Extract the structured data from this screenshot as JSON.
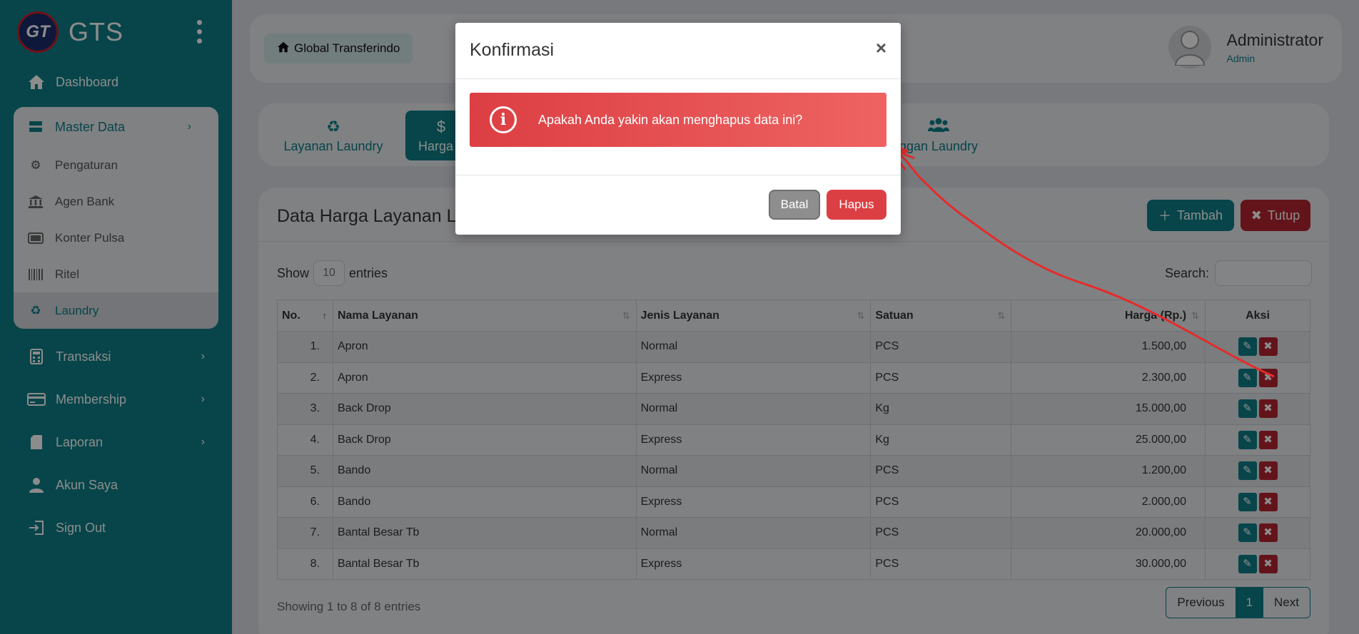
{
  "brand": {
    "logo_text": "GT",
    "name": "GTS"
  },
  "sidebar": {
    "dashboard": "Dashboard",
    "master": {
      "label": "Master Data",
      "items": [
        "Pengaturan",
        "Agen Bank",
        "Konter Pulsa",
        "Ritel",
        "Laundry"
      ]
    },
    "transaksi": "Transaksi",
    "membership": "Membership",
    "laporan": "Laporan",
    "akun": "Akun Saya",
    "signout": "Sign Out"
  },
  "header": {
    "breadcrumb": "Global Transferindo",
    "user_name": "Administrator",
    "user_role": "Admin"
  },
  "tabs": [
    "Layanan Laundry",
    "Harga L",
    "ggan Laundry"
  ],
  "card": {
    "title": "Data Harga Layanan La",
    "add_label": "Tambah",
    "close_label": "Tutup",
    "show_label": "Show",
    "entries_label": "entries",
    "length_value": "10",
    "search_label": "Search:",
    "info": "Showing 1 to 8 of 8 entries",
    "pager": {
      "prev": "Previous",
      "current": "1",
      "next": "Next"
    }
  },
  "table": {
    "headers": [
      "No.",
      "Nama Layanan",
      "Jenis Layanan",
      "Satuan",
      "Harga (Rp.)",
      "Aksi"
    ],
    "rows": [
      [
        "1.",
        "Apron",
        "Normal",
        "PCS",
        "1.500,00"
      ],
      [
        "2.",
        "Apron",
        "Express",
        "PCS",
        "2.300,00"
      ],
      [
        "3.",
        "Back Drop",
        "Normal",
        "Kg",
        "15.000,00"
      ],
      [
        "4.",
        "Back Drop",
        "Express",
        "Kg",
        "25.000,00"
      ],
      [
        "5.",
        "Bando",
        "Normal",
        "PCS",
        "1.200,00"
      ],
      [
        "6.",
        "Bando",
        "Express",
        "PCS",
        "2.000,00"
      ],
      [
        "7.",
        "Bantal Besar Tb",
        "Normal",
        "PCS",
        "20.000,00"
      ],
      [
        "8.",
        "Bantal Besar Tb",
        "Express",
        "PCS",
        "30.000,00"
      ]
    ]
  },
  "modal": {
    "title": "Konfirmasi",
    "close": "×",
    "message": "Apakah Anda yakin akan menghapus data ini?",
    "cancel_label": "Batal",
    "confirm_label": "Hapus"
  },
  "colors": {
    "primary": "#0e7f87",
    "danger": "#dc3f43",
    "annotation": "#e52b2b"
  }
}
